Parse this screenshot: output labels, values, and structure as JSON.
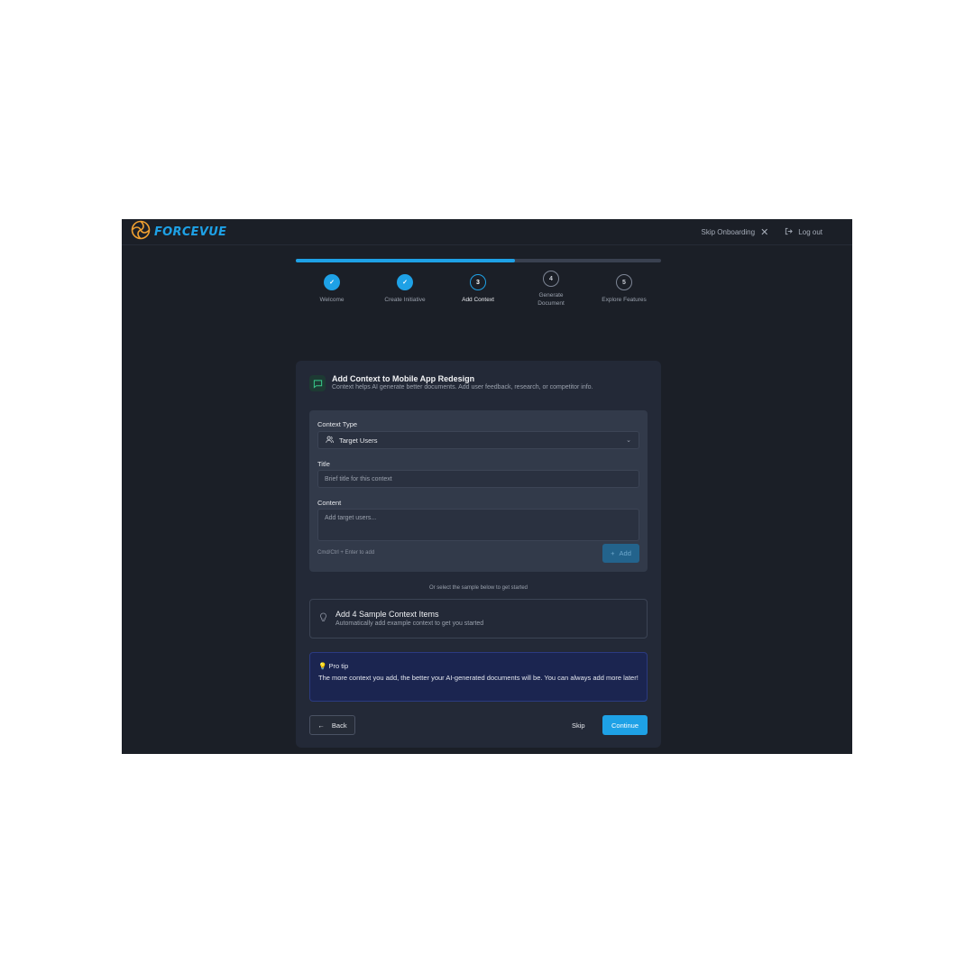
{
  "brand": {
    "name": "FORCEVUE",
    "accent": "#1ea1e6",
    "logo_color": "#f0a030"
  },
  "topbar": {
    "skip_onboarding_label": "Skip Onboarding",
    "logout_label": "Log out",
    "icons": [
      "close-icon",
      "logout-icon"
    ]
  },
  "progress": {
    "fraction": 0.6
  },
  "steps": [
    {
      "number": "1",
      "label": "Welcome",
      "status": "done"
    },
    {
      "number": "2",
      "label": "Create Initiative",
      "status": "done"
    },
    {
      "number": "3",
      "label": "Add Context",
      "status": "current"
    },
    {
      "number": "4",
      "label": "Generate Document",
      "status": "todo"
    },
    {
      "number": "5",
      "label": "Explore Features",
      "status": "todo"
    }
  ],
  "card": {
    "title": "Add Context to Mobile App Redesign",
    "subtitle": "Context helps AI generate better documents. Add user feedback, research, or competitor info.",
    "header_icon": "message-square-icon"
  },
  "form": {
    "context_type_label": "Context Type",
    "context_type_value": "Target Users",
    "context_type_icon": "users-icon",
    "title_label": "Title",
    "title_placeholder": "Brief title for this context",
    "content_label": "Content",
    "content_placeholder": "Add target users...",
    "hint": "Cmd/Ctrl + Enter to add",
    "add_label": "Add"
  },
  "samples": {
    "or_text": "Or select the sample below to get started",
    "title": "Add 4 Sample Context Items",
    "subtitle": "Automatically add example context to get you started",
    "icon": "lightbulb-icon"
  },
  "tip": {
    "title": "Pro tip",
    "text": "The more context you add, the better your AI-generated documents will be. You can always add more later!",
    "icon": "lightbulb-icon"
  },
  "actions": {
    "back_label": "Back",
    "skip_label": "Skip",
    "continue_label": "Continue"
  }
}
